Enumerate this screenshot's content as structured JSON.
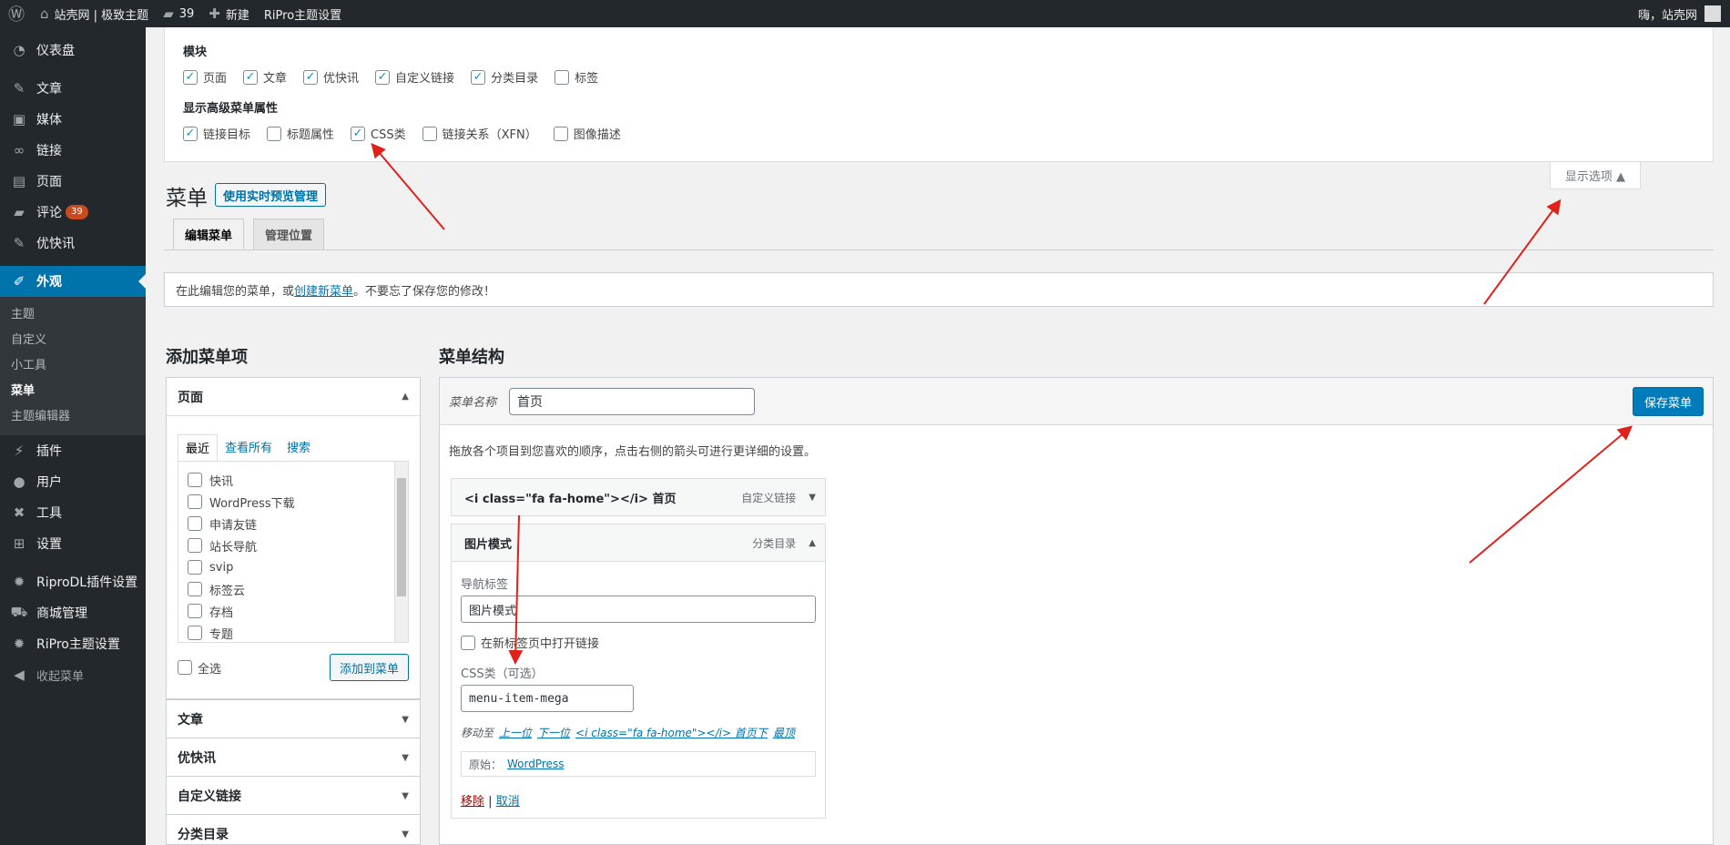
{
  "adminbar": {
    "site_name": "站壳网 | 极致主题",
    "comments": "39",
    "new_label": "新建",
    "theme_settings": "RiPro主题设置",
    "greeting": "嗨，站壳网"
  },
  "sidebar": {
    "dashboard": "仪表盘",
    "posts": "文章",
    "media": "媒体",
    "links": "链接",
    "pages": "页面",
    "comments": "评论",
    "comments_count": "39",
    "news": "优快讯",
    "appearance": "外观",
    "sub": [
      "主题",
      "自定义",
      "小工具",
      "菜单",
      "主题编辑器"
    ],
    "plugins": "插件",
    "users": "用户",
    "tools": "工具",
    "settings": "设置",
    "riprodl": "RiproDL插件设置",
    "shop": "商城管理",
    "ripro": "RiPro主题设置",
    "collapse": "收起菜单"
  },
  "screen_options": {
    "modules_title": "模块",
    "modules": [
      {
        "label": "页面",
        "checked": true
      },
      {
        "label": "文章",
        "checked": true
      },
      {
        "label": "优快讯",
        "checked": true
      },
      {
        "label": "自定义链接",
        "checked": true
      },
      {
        "label": "分类目录",
        "checked": true
      },
      {
        "label": "标签",
        "checked": false
      }
    ],
    "advanced_title": "显示高级菜单属性",
    "advanced": [
      {
        "label": "链接目标",
        "checked": true
      },
      {
        "label": "标题属性",
        "checked": false
      },
      {
        "label": "CSS类",
        "checked": true
      },
      {
        "label": "链接关系（XFN）",
        "checked": false
      },
      {
        "label": "图像描述",
        "checked": false
      }
    ],
    "tab_label": "显示选项 ▲"
  },
  "header": {
    "title": "菜单",
    "preview_button": "使用实时预览管理"
  },
  "tabs": [
    "编辑菜单",
    "管理位置"
  ],
  "notice": {
    "before": "在此编辑您的菜单，或",
    "link": "创建新菜单",
    "after": "。不要忘了保存您的修改！"
  },
  "add_items": {
    "title": "添加菜单项",
    "pages_head": "页面",
    "inner_tabs": [
      "最近",
      "查看所有",
      "搜索"
    ],
    "page_list": [
      "快讯",
      "WordPress下载",
      "申请友链",
      "站长导航",
      "svip",
      "标签云",
      "存档",
      "专题"
    ],
    "select_all": "全选",
    "add_button": "添加到菜单",
    "sections": [
      "文章",
      "优快讯",
      "自定义链接",
      "分类目录"
    ]
  },
  "structure": {
    "title": "菜单结构",
    "name_label": "菜单名称",
    "name_value": "首页",
    "save_button": "保存菜单",
    "instructions": "拖放各个项目到您喜欢的顺序，点击右侧的箭头可进行更详细的设置。",
    "item1": {
      "title": "<i class=\"fa fa-home\"></i> 首页",
      "type": "自定义链接"
    },
    "item2": {
      "title": "图片模式",
      "type": "分类目录",
      "nav_label": "导航标签",
      "nav_value": "图片模式",
      "new_tab": "在新标签页中打开链接",
      "css_label": "CSS类（可选）",
      "css_value": "menu-item-mega",
      "move_label": "移动至",
      "move_up": "上一位",
      "move_down": "下一位",
      "move_under": "<i class=\"fa fa-home\"></i> 首页下",
      "move_top": "最顶",
      "original_label": "原始：",
      "original_link": "WordPress",
      "remove": "移除",
      "sep": "|",
      "cancel": "取消"
    }
  },
  "colors": {
    "accent": "#0073aa",
    "primary_button": "#007cba",
    "sidebar": "#23282d",
    "arrow": "#e0211a"
  }
}
